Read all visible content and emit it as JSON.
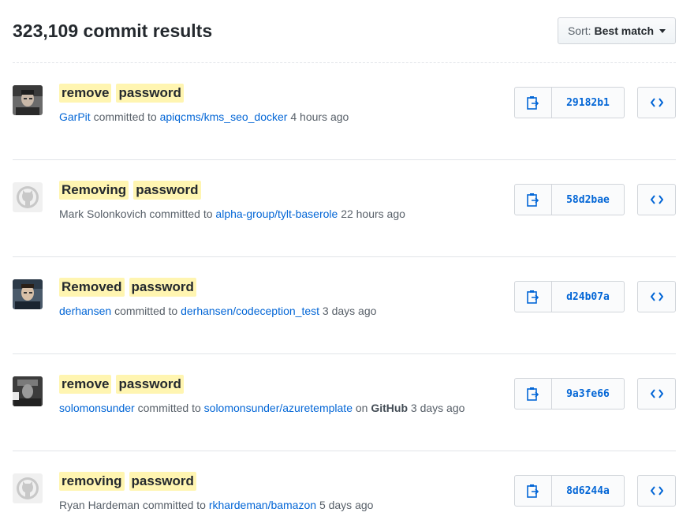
{
  "header": {
    "results_title": "323,109 commit results",
    "sort_label": "Sort:",
    "sort_value": "Best match"
  },
  "colors": {
    "link": "#0366d6",
    "highlight": "#fff5b1",
    "muted": "#586069"
  },
  "commits": [
    {
      "msg_words": [
        "remove",
        "password"
      ],
      "author": "GarPit",
      "author_is_link": true,
      "committed_to": "committed to",
      "repo": "apiqcms/kms_seo_docker",
      "on_label": "",
      "on_value": "",
      "time": "4 hours ago",
      "sha": "29182b1",
      "avatar": "photo-dark"
    },
    {
      "msg_words": [
        "Removing",
        "password"
      ],
      "author": "Mark Solonkovich",
      "author_is_link": false,
      "committed_to": "committed to",
      "repo": "alpha-group/tylt-baserole",
      "on_label": "",
      "on_value": "",
      "time": "22 hours ago",
      "sha": "58d2bae",
      "avatar": "octocat-icon"
    },
    {
      "msg_words": [
        "Removed",
        "password"
      ],
      "author": "derhansen",
      "author_is_link": true,
      "committed_to": "committed to",
      "repo": "derhansen/codeception_test",
      "on_label": "",
      "on_value": "",
      "time": "3 days ago",
      "sha": "d24b07a",
      "avatar": "photo-face"
    },
    {
      "msg_words": [
        "remove",
        "password"
      ],
      "author": "solomonsunder",
      "author_is_link": true,
      "committed_to": "committed to",
      "repo": "solomonsunder/azuretemplate",
      "on_label": "on",
      "on_value": "GitHub",
      "time": "3 days ago",
      "sha": "9a3fe66",
      "avatar": "photo-bw"
    },
    {
      "msg_words": [
        "removing",
        "password"
      ],
      "author": "Ryan Hardeman",
      "author_is_link": false,
      "committed_to": "committed to",
      "repo": "rkhardeman/bamazon",
      "on_label": "",
      "on_value": "",
      "time": "5 days ago",
      "sha": "8d6244a",
      "avatar": "octocat-icon"
    }
  ]
}
